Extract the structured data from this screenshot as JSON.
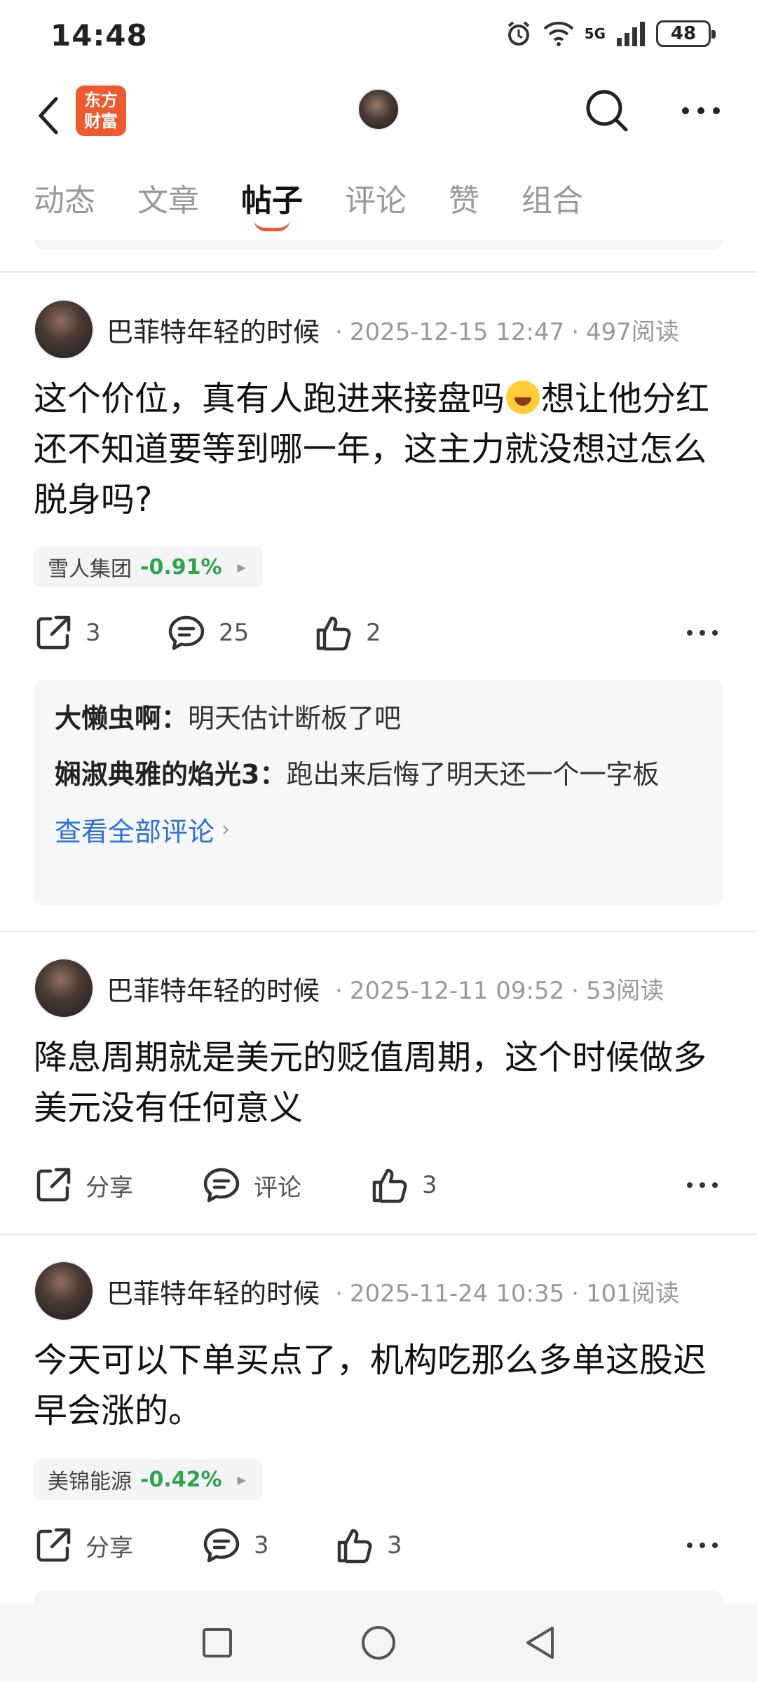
{
  "status_bar": {
    "time": "14:48",
    "battery": "48",
    "network": "5G"
  },
  "nav": {
    "logo_text": "东方财富"
  },
  "tabs": [
    {
      "label": "动态",
      "active": false
    },
    {
      "label": "文章",
      "active": false
    },
    {
      "label": "帖子",
      "active": true
    },
    {
      "label": "评论",
      "active": false
    },
    {
      "label": "赞",
      "active": false
    },
    {
      "label": "组合",
      "active": false
    }
  ],
  "posts": [
    {
      "author": "巴菲特年轻的时候",
      "date": "2025-12-15 12:47",
      "reads": "497阅读",
      "text_a": "这个价位，真有人跑进来接盘吗",
      "text_b": "想让他分红还不知道要等到哪一年，这主力就没想过怎么脱身吗?",
      "stock": {
        "name": "雪人集团",
        "change": "-0.91%"
      },
      "share": "3",
      "comments": "25",
      "likes": "2",
      "comment_list": [
        {
          "user": "大懒虫啊：",
          "text": "明天估计断板了吧"
        },
        {
          "user": "娴淑典雅的焰光3：",
          "text": "跑出来后悔了明天还一个一字板"
        }
      ],
      "view_all": "查看全部评论"
    },
    {
      "author": "巴菲特年轻的时候",
      "date": "2025-12-11 09:52",
      "reads": "53阅读",
      "text": "降息周期就是美元的贬值周期，这个时候做多美元没有任何意义",
      "share": "分享",
      "comments": "评论",
      "likes": "3"
    },
    {
      "author": "巴菲特年轻的时候",
      "date": "2025-11-24 10:35",
      "reads": "101阅读",
      "text": "今天可以下单买点了，机构吃那么多单这股迟早会涨的。",
      "stock": {
        "name": "美锦能源",
        "change": "-0.42%"
      },
      "share": "分享",
      "comments": "3",
      "likes": "3"
    }
  ]
}
